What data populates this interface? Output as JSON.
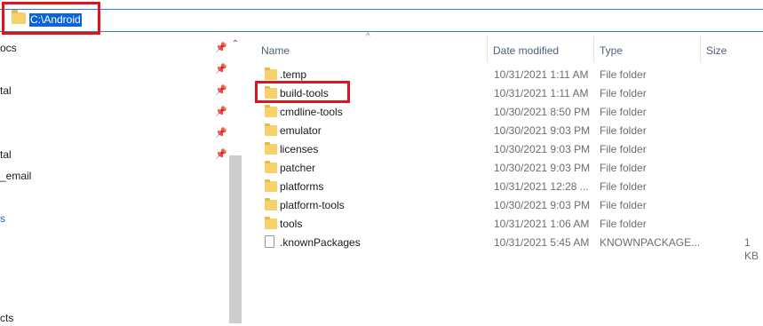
{
  "address_bar": {
    "path": "C:\\Android"
  },
  "nav_pane": {
    "items": [
      {
        "label": "ocs",
        "pinned": true
      },
      {
        "label": "tal",
        "pinned": true
      },
      {
        "label": "",
        "pinned": true
      },
      {
        "label": "",
        "pinned": true
      },
      {
        "label": "tal",
        "pinned": true
      },
      {
        "label": "_email",
        "pinned": false
      },
      {
        "label": "s",
        "pinned": false
      },
      {
        "label": "cts",
        "pinned": false
      }
    ]
  },
  "columns": {
    "name": "Name",
    "date": "Date modified",
    "type": "Type",
    "size": "Size"
  },
  "files": [
    {
      "name": ".temp",
      "date": "10/31/2021 1:11 AM",
      "type": "File folder",
      "size": "",
      "icon": "folder-icon"
    },
    {
      "name": "build-tools",
      "date": "10/31/2021 1:11 AM",
      "type": "File folder",
      "size": "",
      "icon": "folder-icon"
    },
    {
      "name": "cmdline-tools",
      "date": "10/30/2021 8:50 PM",
      "type": "File folder",
      "size": "",
      "icon": "folder-icon"
    },
    {
      "name": "emulator",
      "date": "10/30/2021 9:03 PM",
      "type": "File folder",
      "size": "",
      "icon": "folder-icon"
    },
    {
      "name": "licenses",
      "date": "10/30/2021 9:03 PM",
      "type": "File folder",
      "size": "",
      "icon": "folder-icon"
    },
    {
      "name": "patcher",
      "date": "10/30/2021 9:03 PM",
      "type": "File folder",
      "size": "",
      "icon": "folder-icon"
    },
    {
      "name": "platforms",
      "date": "10/31/2021 12:28 ...",
      "type": "File folder",
      "size": "",
      "icon": "folder-icon"
    },
    {
      "name": "platform-tools",
      "date": "10/30/2021 9:03 PM",
      "type": "File folder",
      "size": "",
      "icon": "folder-icon"
    },
    {
      "name": "tools",
      "date": "10/31/2021 1:06 AM",
      "type": "File folder",
      "size": "",
      "icon": "folder-icon"
    },
    {
      "name": ".knownPackages",
      "date": "10/31/2021 5:45 AM",
      "type": "KNOWNPACKAGE...",
      "size": "1 KB",
      "icon": "file-icon"
    }
  ],
  "colors": {
    "highlight": "#0a64d8",
    "annotation_red": "#e0141e",
    "folder_yellow": "#f7d26b"
  }
}
